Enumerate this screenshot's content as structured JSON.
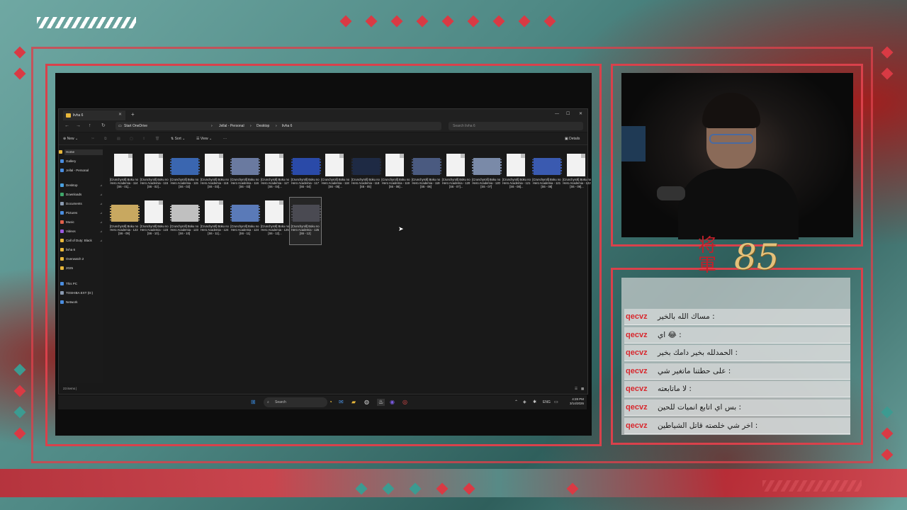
{
  "explorer": {
    "tab_title": "livha 6",
    "breadcrumb": [
      "Start OneDrive",
      "Jellal - Personal",
      "Desktop",
      "livha 6"
    ],
    "search_placeholder": "Search livha 6",
    "toolbar": {
      "new": "New",
      "sort": "Sort",
      "view": "View",
      "details": "Details"
    },
    "sidebar": [
      {
        "label": "Home",
        "icon": "home-icon",
        "color": "#e8b73a"
      },
      {
        "label": "Gallery",
        "icon": "gallery-icon",
        "color": "#4a8de0"
      },
      {
        "label": "Jellal - Personal",
        "icon": "cloud-icon",
        "color": "#4a8de0"
      },
      {
        "label": "Desktop",
        "icon": "desktop-icon",
        "color": "#4aa0e0"
      },
      {
        "label": "Downloads",
        "icon": "download-icon",
        "color": "#3fa66a"
      },
      {
        "label": "Documents",
        "icon": "documents-icon",
        "color": "#8a9ab0"
      },
      {
        "label": "Pictures",
        "icon": "pictures-icon",
        "color": "#4a8de0"
      },
      {
        "label": "Music",
        "icon": "music-icon",
        "color": "#e0604a"
      },
      {
        "label": "Videos",
        "icon": "videos-icon",
        "color": "#9a5ae0"
      },
      {
        "label": "Call of Duty: Black",
        "icon": "folder-icon",
        "color": "#e8b73a"
      },
      {
        "label": "livha 6",
        "icon": "folder-icon",
        "color": "#e8b73a"
      },
      {
        "label": "Overwatch 2",
        "icon": "folder-icon",
        "color": "#e8b73a"
      },
      {
        "label": "2025",
        "icon": "folder-icon",
        "color": "#e8b73a"
      },
      {
        "label": "This PC",
        "icon": "pc-icon",
        "color": "#4a8de0"
      },
      {
        "label": "TOSHIBA EXT (D:)",
        "icon": "drive-icon",
        "color": "#8a9ab0"
      },
      {
        "label": "Network",
        "icon": "network-icon",
        "color": "#4a8de0"
      }
    ],
    "files": [
      {
        "name": "[Crunchyroll] Boku no Hero Academia - 114 [S6 - 01]...",
        "kind": "doc"
      },
      {
        "name": "[Crunchyroll] Boku no Hero Academia - 115 [S6 - 02]...",
        "kind": "doc"
      },
      {
        "name": "[Crunchyroll] Boku no Hero Academia - 115 [S6 - 02]",
        "kind": "vid"
      },
      {
        "name": "[Crunchyroll] Boku no Hero Academia - 116 [S6 - 03]...",
        "kind": "doc"
      },
      {
        "name": "[Crunchyroll] Boku no Hero Academia - 116 [S6 - 03]",
        "kind": "vid"
      },
      {
        "name": "[Crunchyroll] Boku no Hero Academia - 117 [S6 - 04]...",
        "kind": "doc"
      },
      {
        "name": "[Crunchyroll] Boku no Hero Academia - 117 [S6 - 04]",
        "kind": "vid"
      },
      {
        "name": "[Crunchyroll] Boku no Hero Academia - 118 [S6 - 05]...",
        "kind": "doc"
      },
      {
        "name": "[Crunchyroll] Boku no Hero Academia - 118 [S6 - 05]",
        "kind": "vid"
      },
      {
        "name": "[Crunchyroll] Boku no Hero Academia - 119 [S6 - 06]...",
        "kind": "doc"
      },
      {
        "name": "[Crunchyroll] Boku no Hero Academia - 119 [S6 - 06]",
        "kind": "vid"
      },
      {
        "name": "[Crunchyroll] Boku no Hero Academia - 120 [S6 - 07]...",
        "kind": "doc"
      },
      {
        "name": "[Crunchyroll] Boku no Hero Academia - 120 [S6 - 07]",
        "kind": "vid"
      },
      {
        "name": "[Crunchyroll] Boku no Hero Academia - 121 [S6 - 08]...",
        "kind": "doc"
      },
      {
        "name": "[Crunchyroll] Boku no Hero Academia - 121 [S6 - 08]",
        "kind": "vid"
      },
      {
        "name": "[Crunchyroll] Boku no Hero Academia - 122 [S6 - 09]...",
        "kind": "doc"
      },
      {
        "name": "[Crunchyroll] Boku no Hero Academia - 122 [S6 - 09]",
        "kind": "vid"
      },
      {
        "name": "[Crunchyroll] Boku no Hero Academia - 123 [S6 - 10]...",
        "kind": "doc"
      },
      {
        "name": "[Crunchyroll] Boku no Hero Academia - 123 [S6 - 10]",
        "kind": "vid"
      },
      {
        "name": "[Crunchyroll] Boku no Hero Academia - 124 [S6 - 11]...",
        "kind": "doc"
      },
      {
        "name": "[Crunchyroll] Boku no Hero Academia - 124 [S6 - 11]",
        "kind": "vid"
      },
      {
        "name": "[Crunchyroll] Boku no Hero Academia - 125 [S6 - 12]...",
        "kind": "doc"
      },
      {
        "name": "[Crunchyroll] Boku no Hero Academia - 125 [S6 - 12]",
        "kind": "vid"
      }
    ],
    "status": "23 items  |"
  },
  "taskbar": {
    "search_label": "Search",
    "lang": "ENG",
    "time": "4:28 PM",
    "date": "3/14/2026"
  },
  "overlay": {
    "kanji": "将軍",
    "number": "85"
  },
  "chat": {
    "messages": [
      {
        "user": "qecvz",
        "text": "مساك الله بالخير : "
      },
      {
        "user": "qecvz",
        "text": "اي 😂 : "
      },
      {
        "user": "qecvz",
        "text": "الحمدلله بخير دامك بخير : "
      },
      {
        "user": "qecvz",
        "text": "على حطتنا ماتغير شي : "
      },
      {
        "user": "qecvz",
        "text": "لا ماتابعته : "
      },
      {
        "user": "qecvz",
        "text": "بس اي اتابع انميات للحين : "
      },
      {
        "user": "qecvz",
        "text": "اخر شي خلصته قاتل الشياطين : "
      }
    ]
  },
  "colors": {
    "accent_red": "#d93a44",
    "accent_teal": "#3c9b91",
    "gold": "#e4c17a"
  }
}
